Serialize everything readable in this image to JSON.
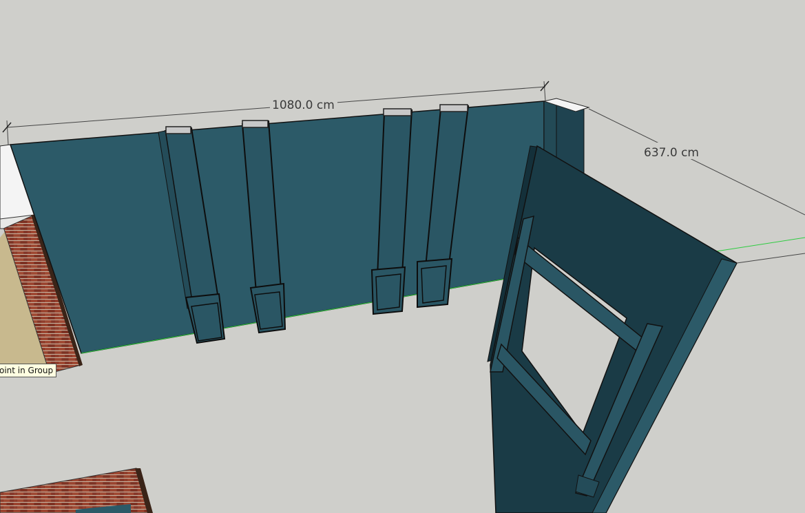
{
  "viewport": {
    "dimensions": {
      "length_label": "1080.0 cm",
      "width_label": "637.0 cm"
    },
    "inference_tooltip": "oint in Group"
  },
  "colors": {
    "background": "#cfcfcb",
    "wall_face": "#2c5a68",
    "wall_side": "#1d3d48",
    "panel_face": "#1a3a44",
    "brick": "#8a3a2a",
    "dimension_line": "#444444",
    "green_axis": "#2ecc40"
  }
}
